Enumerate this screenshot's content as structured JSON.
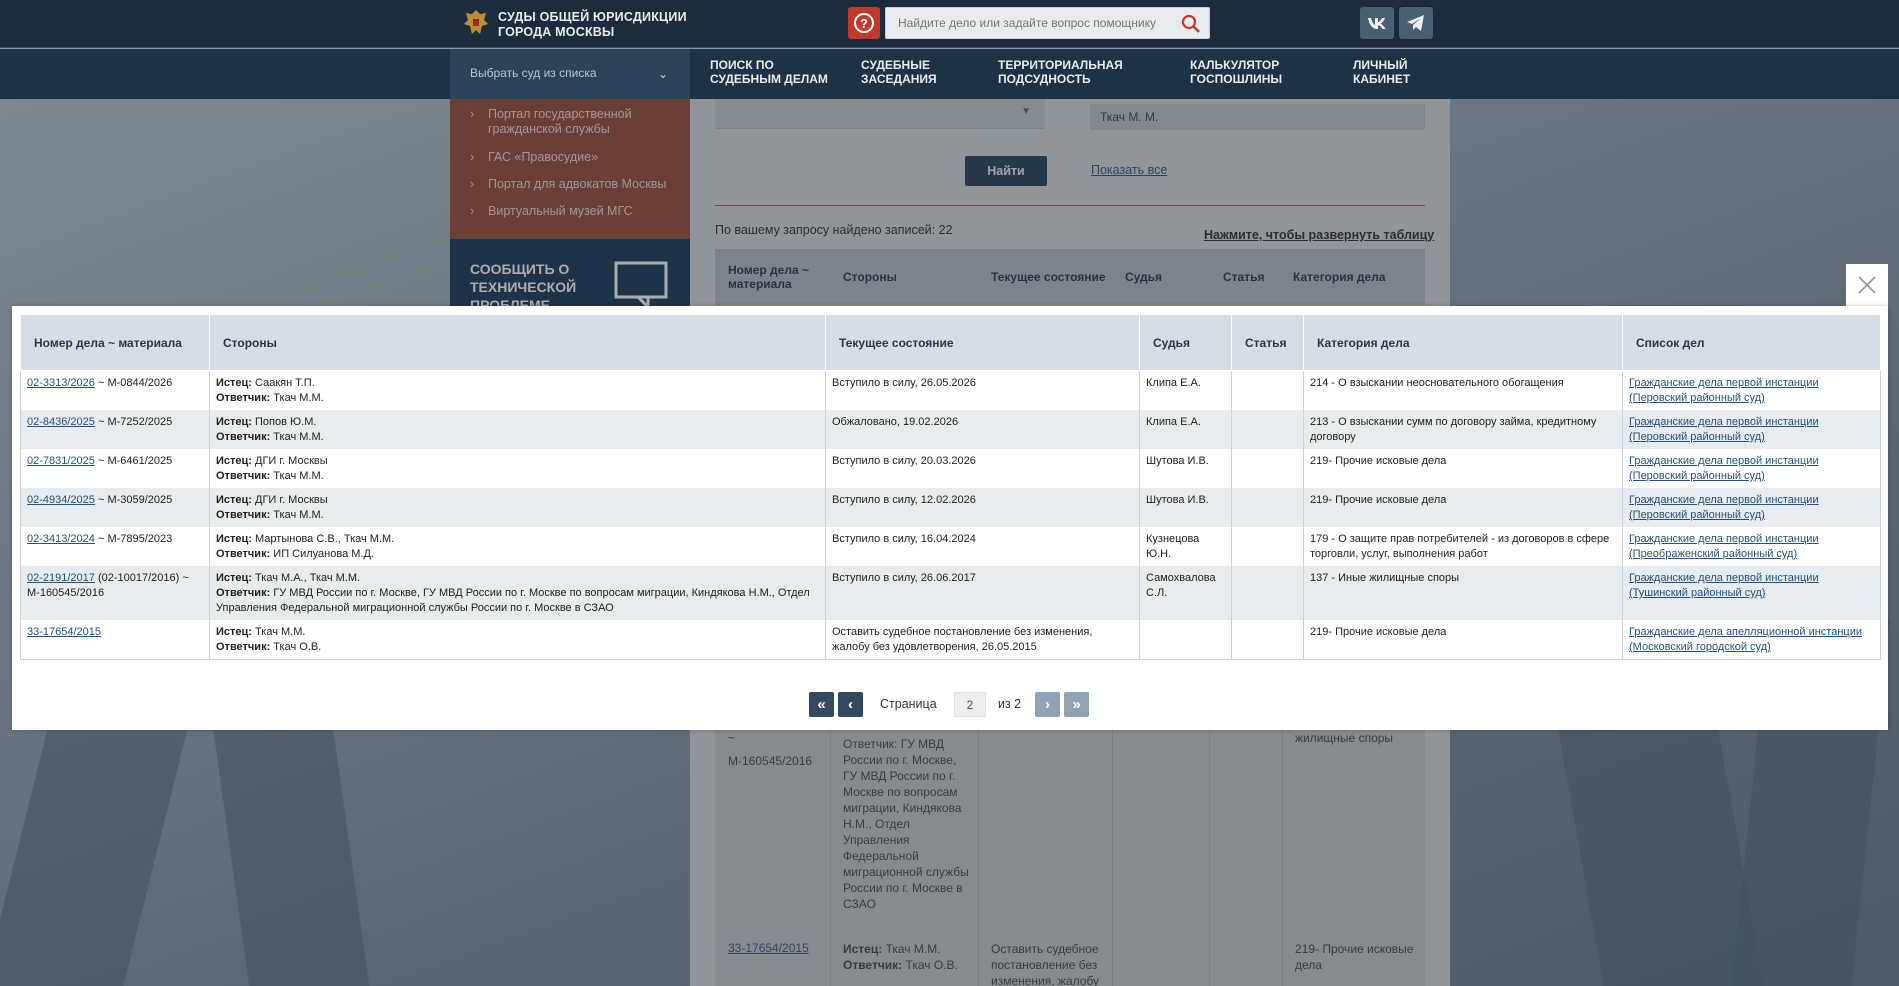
{
  "header": {
    "site_title_line1": "СУДЫ ОБЩЕЙ ЮРИСДИКЦИИ",
    "site_title_line2": "ГОРОДА МОСКВЫ",
    "help_label": "?",
    "search_placeholder": "Найдите дело или задайте вопрос помощнику",
    "search_icon": "search-icon",
    "social": [
      "vk-icon",
      "telegram-icon"
    ]
  },
  "nav": {
    "court_select": "Выбрать суд из списка",
    "items": [
      {
        "line1": "ПОИСК ПО",
        "line2": "СУДЕБНЫМ ДЕЛАМ"
      },
      {
        "line1": "СУДЕБНЫЕ",
        "line2": "ЗАСЕДАНИЯ"
      },
      {
        "line1": "ТЕРРИТОРИАЛЬНАЯ",
        "line2": "ПОДСУДНОСТЬ"
      },
      {
        "line1": "КАЛЬКУЛЯТОР",
        "line2": "ГОСПОШЛИНЫ"
      },
      {
        "line1": "ЛИЧНЫЙ",
        "line2": "КАБИНЕТ"
      }
    ]
  },
  "sidebar": {
    "links": [
      {
        "line1": "Портал государственной",
        "line2": "гражданской службы"
      },
      {
        "line1": "ГАС «Правосудие»",
        "line2": ""
      },
      {
        "line1": "Портал для адвокатов Москвы",
        "line2": ""
      },
      {
        "line1": "Виртуальный музей МГС",
        "line2": ""
      }
    ],
    "report_line1": "СООБЩИТЬ О",
    "report_line2": "ТЕХНИЧЕСКОЙ",
    "report_line3": "ПРОБЛЕМЕ"
  },
  "background_page": {
    "judge_field_value": "Ткач М. М.",
    "find_button": "Найти",
    "show_all": "Показать все",
    "found_text": "По вашему запросу найдено записей: 22",
    "expand_link": "Нажмите, чтобы развернуть таблицу",
    "columns": [
      "Номер дела ~",
      "материала",
      "Стороны",
      "Текущее состояние",
      "Судья",
      "Статья",
      "Категория дела"
    ],
    "row_a_case_end": "~",
    "row_a_case_mat": "М-160545/2016",
    "row_a_parties": [
      "Ответчик: ГУ МВД",
      "России по г. Москве,",
      "ГУ МВД России по г.",
      "Москве по вопросам",
      "миграции, Киндякова",
      "Н.М., Отдел",
      "Управления",
      "Федеральной",
      "миграционной службы",
      "России по г. Москве в",
      "СЗАО"
    ],
    "row_a_category": "жилищные споры",
    "row_b_case": "33-17654/2015",
    "row_b_plaintiff_label": "Истец:",
    "row_b_plaintiff": "Ткач М.М.",
    "row_b_defendant_label": "Ответчик:",
    "row_b_defendant": "Ткач О.В.",
    "row_b_state": [
      "Оставить судебное",
      "постановление без",
      "изменения, жалобу"
    ],
    "row_b_category": [
      "219- Прочие исковые",
      "дела"
    ]
  },
  "modal": {
    "close_icon": "close-icon",
    "columns": [
      "Номер дела ~ материала",
      "Стороны",
      "Текущее состояние",
      "Судья",
      "Статья",
      "Категория дела",
      "Список дел"
    ],
    "plaintiff_label": "Истец:",
    "defendant_label": "Ответчик:",
    "rows": [
      {
        "case_link": "02-3313/2026",
        "case_rest": " ~ М-0844/2026",
        "plaintiff": " Саакян Т.П.",
        "defendant": " Ткач М.М.",
        "state": "Вступило в силу, 26.05.2026",
        "judge": "Клипа Е.А.",
        "article": "",
        "category": "214 - О взыскании неосновательного обогащения",
        "list_link": "Гражданские дела первой инстанции (Перовский районный суд)"
      },
      {
        "case_link": "02-8436/2025",
        "case_rest": " ~ М-7252/2025",
        "plaintiff": " Попов Ю.М.",
        "defendant": " Ткач М.М.",
        "state": "Обжаловано, 19.02.2026",
        "judge": "Клипа Е.А.",
        "article": "",
        "category": "213 - О взыскании сумм по договору займа, кредитному договору",
        "list_link": "Гражданские дела первой инстанции (Перовский районный суд)"
      },
      {
        "case_link": "02-7831/2025",
        "case_rest": " ~ М-6461/2025",
        "plaintiff": " ДГИ г. Москвы",
        "defendant": " Ткач М.М.",
        "state": "Вступило в силу, 20.03.2026",
        "judge": "Шутова И.В.",
        "article": "",
        "category": "219- Прочие исковые дела",
        "list_link": "Гражданские дела первой инстанции (Перовский районный суд)"
      },
      {
        "case_link": "02-4934/2025",
        "case_rest": " ~ М-3059/2025",
        "plaintiff": " ДГИ г. Москвы",
        "defendant": " Ткач М.М.",
        "state": "Вступило в силу, 12.02.2026",
        "judge": "Шутова И.В.",
        "article": "",
        "category": "219- Прочие исковые дела",
        "list_link": "Гражданские дела первой инстанции (Перовский районный суд)"
      },
      {
        "case_link": "02-3413/2024",
        "case_rest": " ~ М-7895/2023",
        "plaintiff": " Мартынова С.В., Ткач М.М.",
        "defendant": " ИП Силуанова М.Д.",
        "state": "Вступило в силу, 16.04.2024",
        "judge": "Кузнецова Ю.Н.",
        "article": "",
        "category": "179 - О защите прав потребителей - из договоров в сфере торговли, услуг, выполнения работ",
        "list_link": "Гражданские дела первой инстанции (Преображенский районный суд)"
      },
      {
        "case_link": "02-2191/2017",
        "case_rest": " (02-10017/2016) ~ М-160545/2016",
        "plaintiff": " Ткач М.А., Ткач М.М.",
        "defendant": " ГУ МВД России по г. Москве, ГУ МВД России по г. Москве по вопросам миграции, Киндякова Н.М., Отдел Управления Федеральной миграционной службы России по г. Москве в СЗАО",
        "state": "Вступило в силу, 26.06.2017",
        "judge": "Самохвалова С.Л.",
        "article": "",
        "category": "137 - Иные жилищные споры",
        "list_link": "Гражданские дела первой инстанции (Тушинский районный суд)"
      },
      {
        "case_link": "33-17654/2015",
        "case_rest": "",
        "plaintiff": " Ткач М.М.",
        "defendant": " Ткач О.В.",
        "state": "Оставить судебное постановление без изменения, жалобу без удовлетворения, 26.05.2015",
        "judge": "",
        "article": "",
        "category": "219- Прочие исковые дела",
        "list_link": "Гражданские дела апелляционной инстанции (Московский городской суд)"
      }
    ]
  },
  "pagination": {
    "first": "«",
    "prev": "‹",
    "label": "Страница",
    "current": "2",
    "total": "из 2",
    "next": "›",
    "last": "»"
  }
}
